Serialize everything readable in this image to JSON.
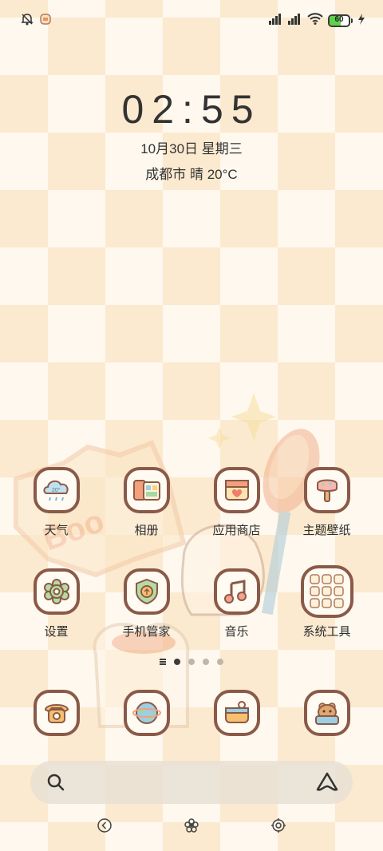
{
  "status_bar": {
    "battery_level": "60",
    "battery_fraction": 0.6,
    "left_icons": [
      "bell-off-icon",
      "notification-app-icon"
    ],
    "right_icons": [
      "signal-icon",
      "signal-icon",
      "wifi-icon",
      "battery-icon",
      "charging-icon"
    ]
  },
  "clock": {
    "time": "02:55",
    "date": "10月30日 星期三",
    "weather": "成都市 晴 20°C"
  },
  "apps": [
    {
      "label": "天气",
      "icon": "weather-icon"
    },
    {
      "label": "相册",
      "icon": "gallery-icon"
    },
    {
      "label": "应用商店",
      "icon": "app-store-icon"
    },
    {
      "label": "主题壁纸",
      "icon": "theme-wallpaper-icon"
    },
    {
      "label": "设置",
      "icon": "settings-icon"
    },
    {
      "label": "手机管家",
      "icon": "security-icon"
    },
    {
      "label": "音乐",
      "icon": "music-icon"
    },
    {
      "label": "系统工具",
      "icon": "system-tools-folder-icon"
    }
  ],
  "weather_icon_text": "20°",
  "pages": {
    "count": 4,
    "active_index": 0
  },
  "dock": [
    {
      "icon": "phone-icon"
    },
    {
      "icon": "browser-icon"
    },
    {
      "icon": "messages-icon"
    },
    {
      "icon": "camera-icon"
    }
  ],
  "colors": {
    "icon_border": "#8a5a48",
    "background_light": "#fef8ee",
    "background_dark": "#fbeacf"
  }
}
